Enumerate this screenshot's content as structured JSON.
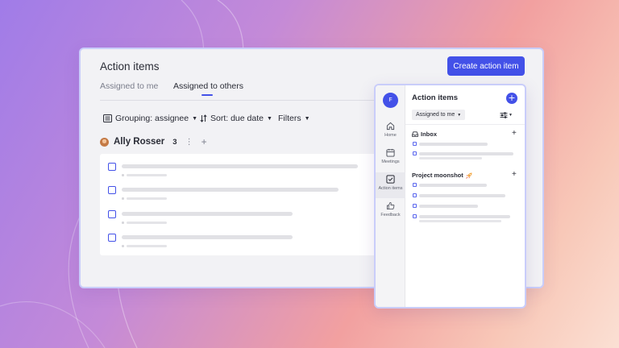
{
  "main": {
    "title": "Action items",
    "create_button": "Create action item",
    "tabs": [
      {
        "label": "Assigned to me",
        "active": false
      },
      {
        "label": "Assigned to others",
        "active": true
      }
    ],
    "toolbar": {
      "grouping": "Grouping: assignee",
      "sort": "Sort: due date",
      "filters": "Filters"
    },
    "assignee": {
      "name": "Ally Rosser",
      "count": "3"
    }
  },
  "panel": {
    "user_initial": "F",
    "title": "Action items",
    "assigned_dropdown": "Assigned to me",
    "nav": [
      {
        "label": "Home",
        "icon": "home-icon"
      },
      {
        "label": "Meetings",
        "icon": "calendar-icon"
      },
      {
        "label": "Action items",
        "icon": "checkbox-icon"
      },
      {
        "label": "Feedback",
        "icon": "thumbs-up-icon"
      }
    ],
    "sections": [
      {
        "label": "Inbox",
        "icon": "inbox-icon"
      },
      {
        "label": "Project moonshot",
        "icon": "rocket-icon"
      }
    ]
  },
  "colors": {
    "accent": "#4351e8",
    "panel_border": "#c9cdfa",
    "placeholder": "#e1e1e5"
  }
}
